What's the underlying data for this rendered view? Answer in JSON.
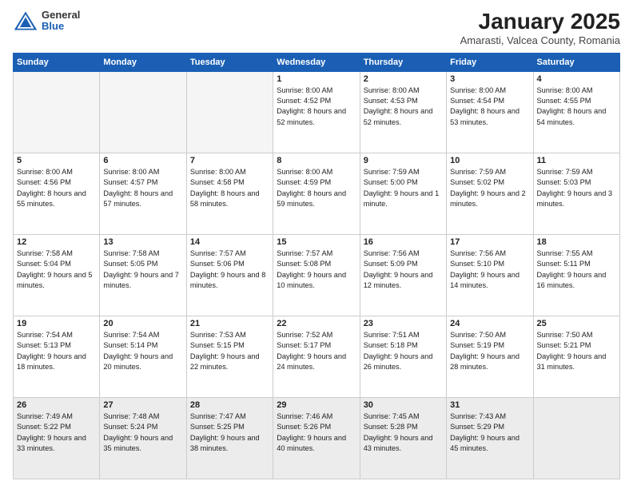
{
  "header": {
    "logo_general": "General",
    "logo_blue": "Blue",
    "month_title": "January 2025",
    "location": "Amarasti, Valcea County, Romania"
  },
  "weekdays": [
    "Sunday",
    "Monday",
    "Tuesday",
    "Wednesday",
    "Thursday",
    "Friday",
    "Saturday"
  ],
  "weeks": [
    [
      {
        "day": "",
        "info": ""
      },
      {
        "day": "",
        "info": ""
      },
      {
        "day": "",
        "info": ""
      },
      {
        "day": "1",
        "info": "Sunrise: 8:00 AM\nSunset: 4:52 PM\nDaylight: 8 hours and 52 minutes."
      },
      {
        "day": "2",
        "info": "Sunrise: 8:00 AM\nSunset: 4:53 PM\nDaylight: 8 hours and 52 minutes."
      },
      {
        "day": "3",
        "info": "Sunrise: 8:00 AM\nSunset: 4:54 PM\nDaylight: 8 hours and 53 minutes."
      },
      {
        "day": "4",
        "info": "Sunrise: 8:00 AM\nSunset: 4:55 PM\nDaylight: 8 hours and 54 minutes."
      }
    ],
    [
      {
        "day": "5",
        "info": "Sunrise: 8:00 AM\nSunset: 4:56 PM\nDaylight: 8 hours and 55 minutes."
      },
      {
        "day": "6",
        "info": "Sunrise: 8:00 AM\nSunset: 4:57 PM\nDaylight: 8 hours and 57 minutes."
      },
      {
        "day": "7",
        "info": "Sunrise: 8:00 AM\nSunset: 4:58 PM\nDaylight: 8 hours and 58 minutes."
      },
      {
        "day": "8",
        "info": "Sunrise: 8:00 AM\nSunset: 4:59 PM\nDaylight: 8 hours and 59 minutes."
      },
      {
        "day": "9",
        "info": "Sunrise: 7:59 AM\nSunset: 5:00 PM\nDaylight: 9 hours and 1 minute."
      },
      {
        "day": "10",
        "info": "Sunrise: 7:59 AM\nSunset: 5:02 PM\nDaylight: 9 hours and 2 minutes."
      },
      {
        "day": "11",
        "info": "Sunrise: 7:59 AM\nSunset: 5:03 PM\nDaylight: 9 hours and 3 minutes."
      }
    ],
    [
      {
        "day": "12",
        "info": "Sunrise: 7:58 AM\nSunset: 5:04 PM\nDaylight: 9 hours and 5 minutes."
      },
      {
        "day": "13",
        "info": "Sunrise: 7:58 AM\nSunset: 5:05 PM\nDaylight: 9 hours and 7 minutes."
      },
      {
        "day": "14",
        "info": "Sunrise: 7:57 AM\nSunset: 5:06 PM\nDaylight: 9 hours and 8 minutes."
      },
      {
        "day": "15",
        "info": "Sunrise: 7:57 AM\nSunset: 5:08 PM\nDaylight: 9 hours and 10 minutes."
      },
      {
        "day": "16",
        "info": "Sunrise: 7:56 AM\nSunset: 5:09 PM\nDaylight: 9 hours and 12 minutes."
      },
      {
        "day": "17",
        "info": "Sunrise: 7:56 AM\nSunset: 5:10 PM\nDaylight: 9 hours and 14 minutes."
      },
      {
        "day": "18",
        "info": "Sunrise: 7:55 AM\nSunset: 5:11 PM\nDaylight: 9 hours and 16 minutes."
      }
    ],
    [
      {
        "day": "19",
        "info": "Sunrise: 7:54 AM\nSunset: 5:13 PM\nDaylight: 9 hours and 18 minutes."
      },
      {
        "day": "20",
        "info": "Sunrise: 7:54 AM\nSunset: 5:14 PM\nDaylight: 9 hours and 20 minutes."
      },
      {
        "day": "21",
        "info": "Sunrise: 7:53 AM\nSunset: 5:15 PM\nDaylight: 9 hours and 22 minutes."
      },
      {
        "day": "22",
        "info": "Sunrise: 7:52 AM\nSunset: 5:17 PM\nDaylight: 9 hours and 24 minutes."
      },
      {
        "day": "23",
        "info": "Sunrise: 7:51 AM\nSunset: 5:18 PM\nDaylight: 9 hours and 26 minutes."
      },
      {
        "day": "24",
        "info": "Sunrise: 7:50 AM\nSunset: 5:19 PM\nDaylight: 9 hours and 28 minutes."
      },
      {
        "day": "25",
        "info": "Sunrise: 7:50 AM\nSunset: 5:21 PM\nDaylight: 9 hours and 31 minutes."
      }
    ],
    [
      {
        "day": "26",
        "info": "Sunrise: 7:49 AM\nSunset: 5:22 PM\nDaylight: 9 hours and 33 minutes."
      },
      {
        "day": "27",
        "info": "Sunrise: 7:48 AM\nSunset: 5:24 PM\nDaylight: 9 hours and 35 minutes."
      },
      {
        "day": "28",
        "info": "Sunrise: 7:47 AM\nSunset: 5:25 PM\nDaylight: 9 hours and 38 minutes."
      },
      {
        "day": "29",
        "info": "Sunrise: 7:46 AM\nSunset: 5:26 PM\nDaylight: 9 hours and 40 minutes."
      },
      {
        "day": "30",
        "info": "Sunrise: 7:45 AM\nSunset: 5:28 PM\nDaylight: 9 hours and 43 minutes."
      },
      {
        "day": "31",
        "info": "Sunrise: 7:43 AM\nSunset: 5:29 PM\nDaylight: 9 hours and 45 minutes."
      },
      {
        "day": "",
        "info": ""
      }
    ]
  ]
}
